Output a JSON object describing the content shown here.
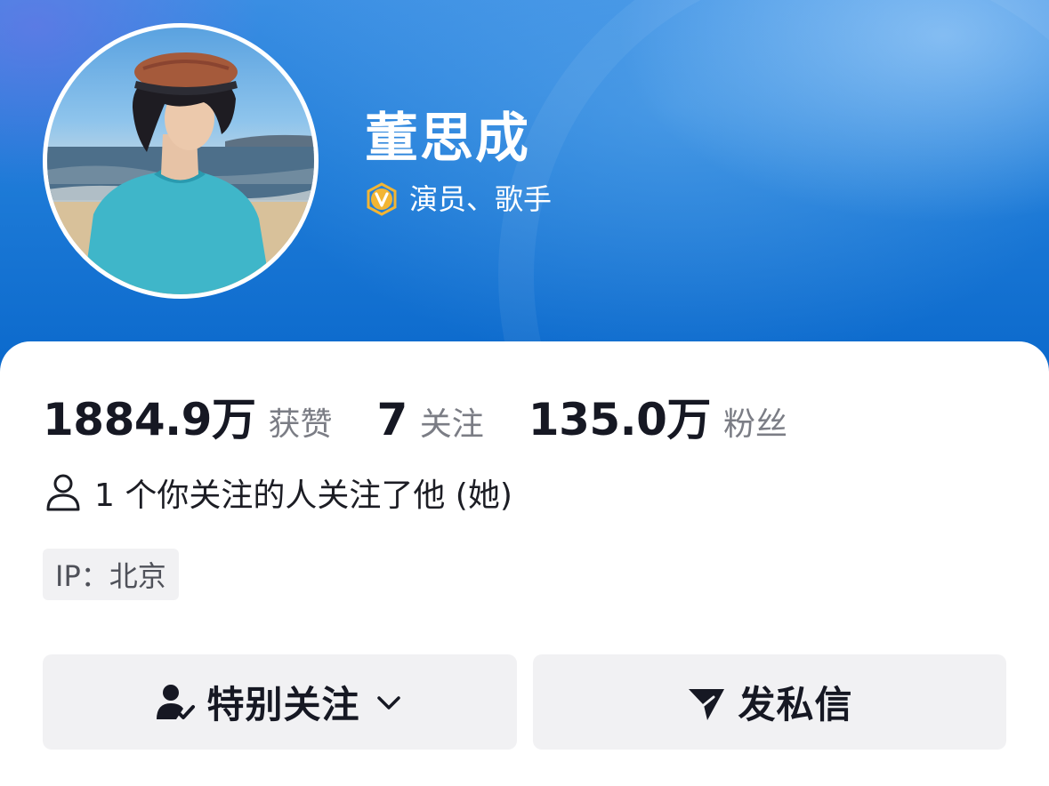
{
  "profile": {
    "name": "董思成",
    "verify_text": "演员、歌手",
    "verify_color": "#f2b534"
  },
  "stats": [
    {
      "num": "1884.9万",
      "label": "获赞"
    },
    {
      "num": "7",
      "label": "关注"
    },
    {
      "num": "135.0万",
      "label": "粉丝"
    }
  ],
  "mutual": {
    "text": "1 个你关注的人关注了他 (她)",
    "icon": "person-outline-icon"
  },
  "ip": {
    "text": "IP：北京"
  },
  "actions": {
    "follow_label": "特别关注",
    "follow_icon": "person-check-icon",
    "message_label": "发私信",
    "message_icon": "send-icon"
  },
  "colors": {
    "header_blue": "#1f7cd8",
    "text_primary": "#161823",
    "text_secondary": "#7b7d85",
    "button_bg": "#f1f1f3"
  }
}
